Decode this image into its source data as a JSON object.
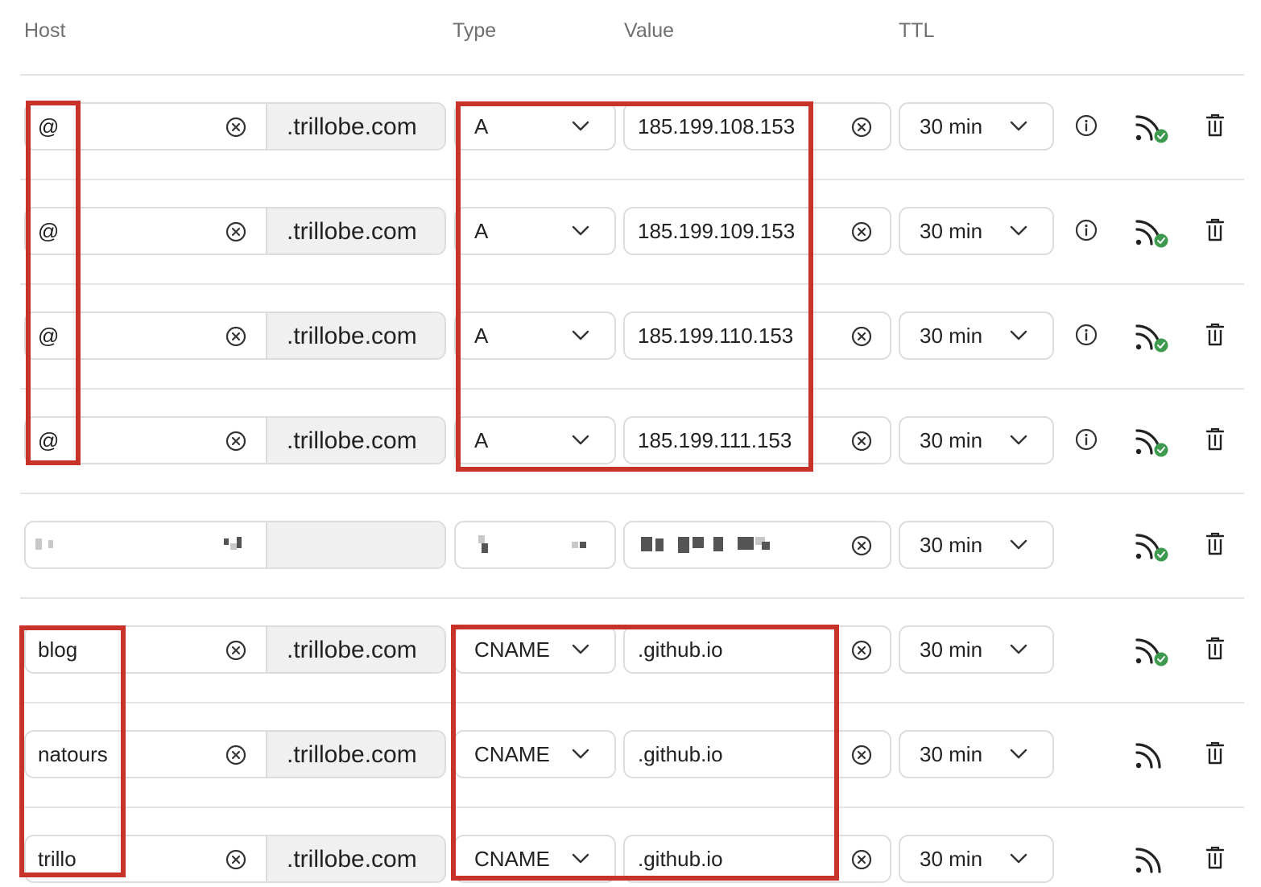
{
  "header": {
    "host": "Host",
    "type": "Type",
    "value": "Value",
    "ttl": "TTL"
  },
  "records": [
    {
      "host": "@",
      "domain_suffix": ".trillobe.com",
      "type": "A",
      "value": "185.199.108.153",
      "ttl": "30 min",
      "has_info": true,
      "status": "verified"
    },
    {
      "host": "@",
      "domain_suffix": ".trillobe.com",
      "type": "A",
      "value": "185.199.109.153",
      "ttl": "30 min",
      "has_info": true,
      "status": "verified"
    },
    {
      "host": "@",
      "domain_suffix": ".trillobe.com",
      "type": "A",
      "value": "185.199.110.153",
      "ttl": "30 min",
      "has_info": true,
      "status": "verified"
    },
    {
      "host": "@",
      "domain_suffix": ".trillobe.com",
      "type": "A",
      "value": "185.199.111.153",
      "ttl": "30 min",
      "has_info": true,
      "status": "verified"
    },
    {
      "host": "",
      "domain_suffix": "",
      "type": "",
      "value": "",
      "ttl": "30 min",
      "has_info": false,
      "status": "verified",
      "redacted": true
    },
    {
      "host": "blog",
      "domain_suffix": ".trillobe.com",
      "type": "CNAME",
      "value": ".github.io",
      "ttl": "30 min",
      "has_info": false,
      "status": "verified"
    },
    {
      "host": "natours",
      "domain_suffix": ".trillobe.com",
      "type": "CNAME",
      "value": ".github.io",
      "ttl": "30 min",
      "has_info": false,
      "status": "pending"
    },
    {
      "host": "trillo",
      "domain_suffix": ".trillobe.com",
      "type": "CNAME",
      "value": ".github.io",
      "ttl": "30 min",
      "has_info": false,
      "status": "pending"
    }
  ],
  "colors": {
    "highlight": "#c8322a",
    "verified": "#3d9a4f"
  },
  "icons": {
    "clear": "circle-x-icon",
    "dropdown": "chevron-down-icon",
    "info": "info-circle-icon",
    "status": "rss-feed-icon",
    "delete": "trash-icon"
  }
}
